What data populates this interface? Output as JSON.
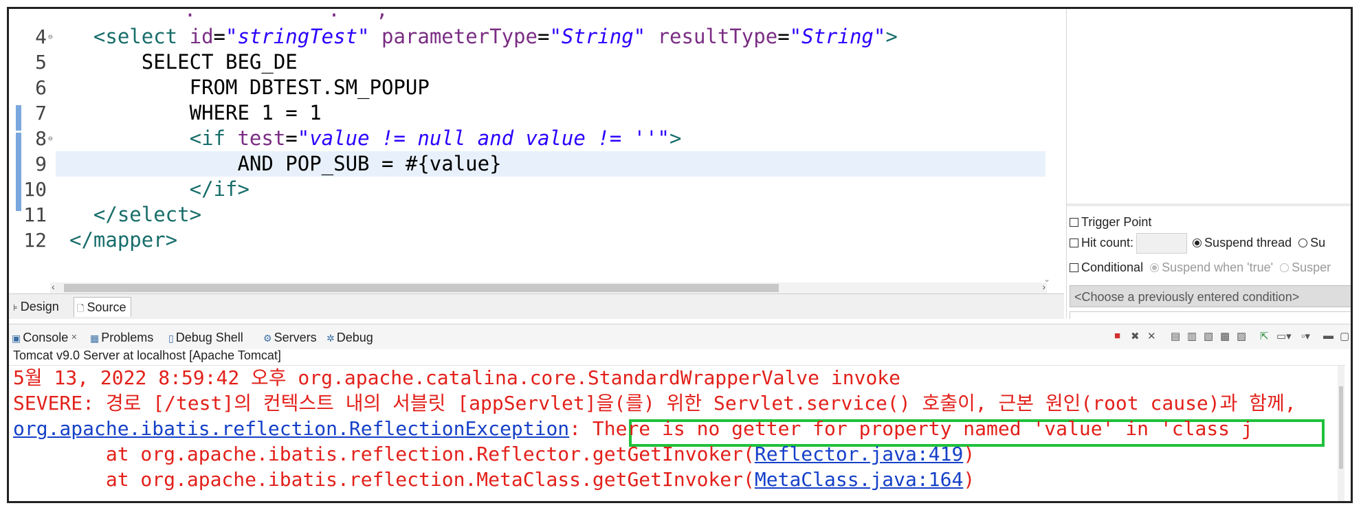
{
  "editor": {
    "lines": [
      {
        "num": "4",
        "indent": "  ",
        "parts": [
          [
            "tag",
            "<select "
          ],
          [
            "attr",
            "id"
          ],
          [
            "p",
            "="
          ],
          [
            "str",
            "\"stringTest\""
          ],
          [
            "p",
            " "
          ],
          [
            "attr",
            "parameterType"
          ],
          [
            "p",
            "="
          ],
          [
            "str",
            "\"String\""
          ],
          [
            "p",
            " "
          ],
          [
            "attr",
            "resultType"
          ],
          [
            "p",
            "="
          ],
          [
            "str",
            "\"String\""
          ],
          [
            "tag",
            ">"
          ]
        ],
        "fold": true
      },
      {
        "num": "5",
        "indent": "      ",
        "parts": [
          [
            "p",
            "SELECT BEG_DE"
          ]
        ]
      },
      {
        "num": "6",
        "indent": "          ",
        "parts": [
          [
            "p",
            "FROM DBTEST.SM_POPUP"
          ]
        ]
      },
      {
        "num": "7",
        "indent": "          ",
        "parts": [
          [
            "p",
            "WHERE 1 = 1"
          ]
        ]
      },
      {
        "num": "8",
        "indent": "          ",
        "parts": [
          [
            "tag",
            "<if "
          ],
          [
            "attr",
            "test"
          ],
          [
            "p",
            "="
          ],
          [
            "str",
            "\"value != null and value != ''\""
          ],
          [
            "tag",
            ">"
          ]
        ],
        "fold": true
      },
      {
        "num": "9",
        "indent": "              ",
        "parts": [
          [
            "p",
            "AND POP_SUB = #{value}"
          ]
        ],
        "current": true
      },
      {
        "num": "10",
        "indent": "          ",
        "parts": [
          [
            "tag",
            "</if>"
          ]
        ]
      },
      {
        "num": "11",
        "indent": "  ",
        "parts": [
          [
            "tag",
            "</select>"
          ]
        ]
      },
      {
        "num": "12",
        "indent": "",
        "parts": [
          [
            "tag",
            "</mapper>"
          ]
        ]
      }
    ]
  },
  "design_tab": "Design",
  "source_tab": "Source",
  "breakpoint": {
    "trigger_point": "Trigger Point",
    "hit_count": "Hit count:",
    "suspend_thread": "Suspend thread",
    "suspend_vm": "Su",
    "conditional": "Conditional",
    "suspend_true": "Suspend when 'true'",
    "suspend_changed": "Susper",
    "condition_placeholder": "<Choose a previously entered condition>"
  },
  "console_tabs": [
    {
      "label": "Console",
      "icon": "▣"
    },
    {
      "label": "Problems",
      "icon": "▦"
    },
    {
      "label": "Debug Shell",
      "icon": "▯"
    },
    {
      "label": "Servers",
      "icon": "⚙"
    },
    {
      "label": "Debug",
      "icon": "✲"
    }
  ],
  "console_title": "Tomcat v9.0 Server at localhost [Apache Tomcat]",
  "console_lines": [
    {
      "text": "5월 13, 2022 8:59:42 오후 org.apache.catalina.core.StandardWrapperValve invoke"
    },
    {
      "text": "SEVERE: 경로 [/test]의 컨텍스트 내의 서블릿 [appServlet]을(를) 위한 Servlet.service() 호출이, 근본 원인(root cause)과 함께,"
    },
    {
      "link": "org.apache.ibatis.reflection.ReflectionException",
      "text": ": There is no getter for property named 'value' in 'class j"
    },
    {
      "text": "        at org.apache.ibatis.reflection.Reflector.getGetInvoker(",
      "link2": "Reflector.java:419",
      "tail": ")"
    },
    {
      "text": "        at org.apache.ibatis.reflection.MetaClass.getGetInvoker(",
      "link2": "MetaClass.java:164",
      "tail": ")"
    }
  ]
}
